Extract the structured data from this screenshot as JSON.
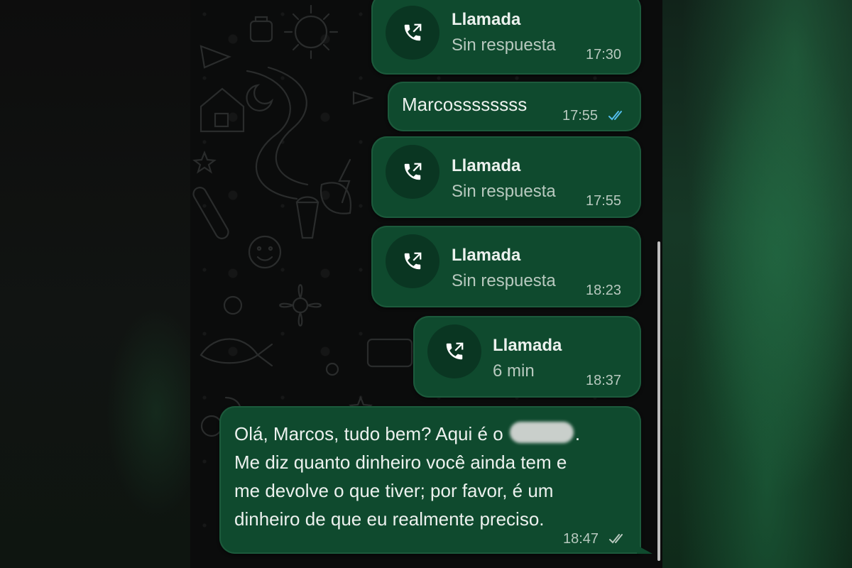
{
  "messages": [
    {
      "kind": "call",
      "title": "Llamada",
      "status": "Sin respuesta",
      "time": "17:30"
    },
    {
      "kind": "text",
      "text": "Marcossssssss",
      "time": "17:55",
      "ticks": "read"
    },
    {
      "kind": "call",
      "title": "Llamada",
      "status": "Sin respuesta",
      "time": "17:55"
    },
    {
      "kind": "call",
      "title": "Llamada",
      "status": "Sin respuesta",
      "time": "18:23"
    },
    {
      "kind": "call",
      "title": "Llamada",
      "status": "6 min",
      "time": "18:37"
    },
    {
      "kind": "text",
      "lines": [
        "Olá, Marcos, tudo bem? Aqui é o",
        ".",
        "Me diz quanto dinheiro você ainda tem e",
        "me devolve o que tiver; por favor, é um",
        "dinheiro de que eu realmente preciso."
      ],
      "time": "18:47",
      "ticks": "delivered"
    }
  ],
  "colors": {
    "bubble": "#0f4a2e",
    "bubble_border": "#1c5a3c",
    "read_ticks": "#53bdeb",
    "delivered_ticks": "#b8c9bf"
  },
  "icons": {
    "outgoing_call": "outgoing-call-icon"
  }
}
